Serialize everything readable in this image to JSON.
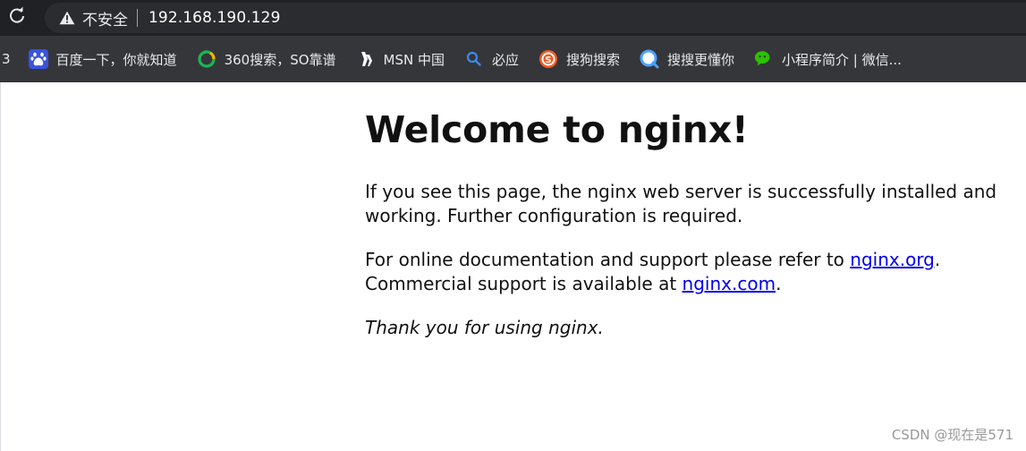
{
  "browser": {
    "security_label": "不安全",
    "url": "192.168.190.129",
    "bookmarks_stub": "3",
    "bookmarks": [
      {
        "label": "百度一下，你就知道",
        "icon": "baidu-paw-icon",
        "color": "#3853e0"
      },
      {
        "label": "360搜索，SO靠谱",
        "icon": "360-search-icon",
        "color": "#19b955"
      },
      {
        "label": "MSN 中国",
        "icon": "msn-butterfly-icon",
        "color": "#ffffff"
      },
      {
        "label": "必应",
        "icon": "bing-search-icon",
        "color": "#3b8beb"
      },
      {
        "label": "搜狗搜索",
        "icon": "sogou-icon",
        "color": "#f05a23"
      },
      {
        "label": "搜搜更懂你",
        "icon": "soso-icon",
        "color": "#4da3ff"
      },
      {
        "label": "小程序简介 | 微信...",
        "icon": "wechat-icon",
        "color": "#2dc100"
      }
    ]
  },
  "page": {
    "heading": "Welcome to nginx!",
    "para1": "If you see this page, the nginx web server is successfully installed and working. Further configuration is required.",
    "para2_prefix": "For online documentation and support please refer to ",
    "link_org": "nginx.org",
    "para2_mid": ".",
    "para3_prefix": "Commercial support is available at ",
    "link_com": "nginx.com",
    "para3_suffix": ".",
    "thanks": "Thank you for using nginx."
  },
  "watermark": "CSDN @现在是571"
}
